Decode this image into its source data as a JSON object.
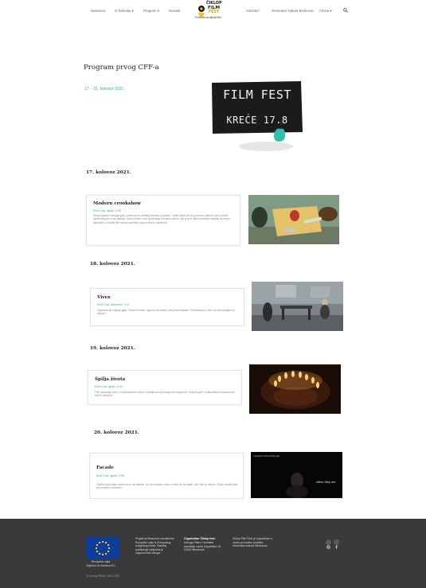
{
  "nav": {
    "items": [
      "Naslovna",
      "O festivalu",
      "Program",
      "Novosti"
    ],
    "right_items": [
      "Volonteri",
      "Generator kultura Benkovac",
      "Arhiva"
    ],
    "logo_text_top": "ČIKLOP",
    "logo_text_mid": "FILM",
    "logo_text_bot": "FEST",
    "logo_sub": "Festival za dječji film"
  },
  "page": {
    "title": "Program prvog CFF-a",
    "dates": "17. - 21. kolovoz 2021.",
    "poster_line1": "FILM FEST",
    "poster_line2": "KREĆE 17.8"
  },
  "days": [
    {
      "heading": "17. kolovoz 2021.",
      "film": {
        "title": "Modern crookshow",
        "meta": "Emil Ćuić, igrani, 1:44",
        "desc": "Zbog nejasnih razloga ljudi i predmeti se prestaju kretati u prostoru. Jedini način da se ponovno pokrenu jest pronaći osobu koja je uzrok zastoja. Lijepi primjer nove generacije domaćih autora čije je prvo djelo pokazalo osjećaj za ritam i atmosferu, a kratki film donosi zanimljiv spoj humora i napetosti."
      }
    },
    {
      "heading": "18. kolovoz 2021.",
      "film": {
        "title": "Vivex",
        "meta": "Emil Ćuić, animirani, 0:47",
        "desc": "Sigurnost se mijenja gdje? Robot ili kolac, sigurno da bacam prst preko kartice? Sinai tada je u velu da vas postigne pr ostrva?"
      }
    },
    {
      "heading": "19. kolovoz 2021.",
      "film": {
        "title": "Špilja života",
        "meta": "Emil Ćuić, igrani, 4:41",
        "desc": "Film prikazuje priču o kompliciranom životu i pitanjima koja ostaju bez odgovora. Svijeće gore, a atmosfera prostora nosi težinu trenutka."
      }
    },
    {
      "heading": "20. kolovoz 2021.",
      "film": {
        "title": "Facade",
        "meta": "Emil Ćuić, igrani, 2:56",
        "desc": "Osoba koja izlaže svoje lice je iza fasade. No ne možemo znati o tome što je vidjeti, vidi i što je važnije. Dvoje mladih ljudi se suočava i prihvaća."
      },
      "img_caption_top": "I wonder if there they are",
      "img_caption_bottom": "when they are"
    }
  ],
  "footer": {
    "eu_line1": "Europska unija",
    "eu_line2": "Zajedno do fondova EU",
    "col1": "Projekt je financiran sredstvima Europske unije iz Europskog socijalnog fonda. Sadržaj publikacije isključiva je odgovornost udruge.",
    "col2_title": "Organizator Čiklop fest:",
    "col2": "Udruga Piktro, Hrvatske branitelje Ivana Zapadnika 18, 23420 Benkovac",
    "col3": "Čiklop Film Fest je organiziran u okviru provedbe projekta Generator kultura Benkovac.",
    "copyright": "© Udruga Piktro 2020-2021"
  },
  "colors": {
    "accent": "#25b3b0",
    "footer_bg": "#3a3a3a",
    "eu_blue": "#0d3e9a",
    "eu_star": "#ffd42a"
  }
}
